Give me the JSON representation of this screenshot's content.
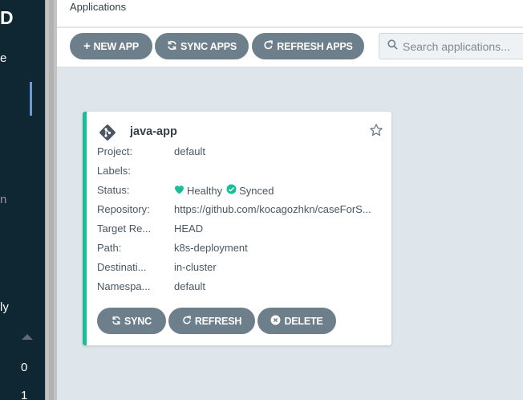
{
  "sidebar": {
    "logo_fragment": "D",
    "version_fragment": "e",
    "item_fragment_n": "n",
    "item_fragment_ly": "ly",
    "count_0": "0",
    "count_1": "1"
  },
  "header": {
    "title": "Applications"
  },
  "toolbar": {
    "new_app": "NEW APP",
    "sync_apps": "SYNC APPS",
    "refresh_apps": "REFRESH APPS",
    "search_placeholder": "Search applications..."
  },
  "app": {
    "name": "java-app",
    "fields": [
      {
        "label": "Project:",
        "value": "default"
      },
      {
        "label": "Labels:",
        "value": ""
      },
      {
        "label": "Status:",
        "health": "Healthy",
        "sync": "Synced"
      },
      {
        "label": "Repository:",
        "value": "https://github.com/kocagozhkn/caseForS..."
      },
      {
        "label": "Target Re...",
        "value": "HEAD"
      },
      {
        "label": "Path:",
        "value": "k8s-deployment"
      },
      {
        "label": "Destinati...",
        "value": "in-cluster"
      },
      {
        "label": "Namespa...",
        "value": "default"
      }
    ],
    "actions": {
      "sync": "SYNC",
      "refresh": "REFRESH",
      "delete": "DELETE"
    }
  },
  "colors": {
    "healthy": "#18be94",
    "button": "#6d7f8b",
    "sidebar": "#0f2733",
    "accent": "#6d9bd8"
  }
}
